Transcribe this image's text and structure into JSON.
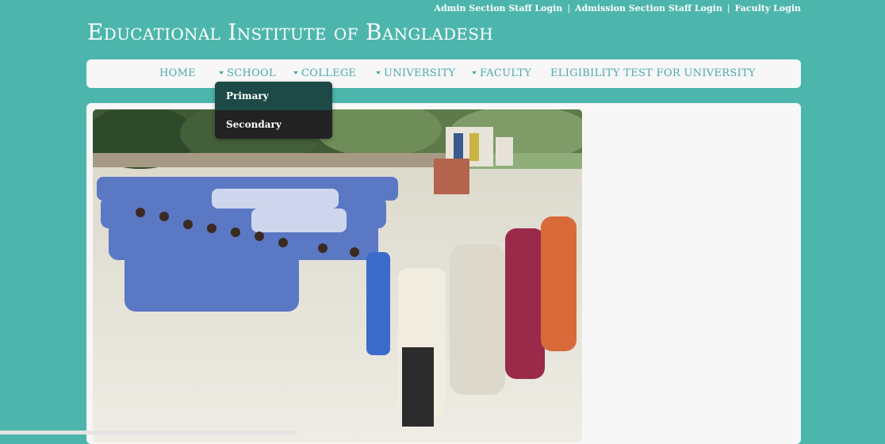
{
  "header": {
    "title": "Educational Institute of Bangladesh",
    "top_links": [
      "Admin Section Staff Login",
      "Admission Section Staff Login",
      "Faculty Login"
    ],
    "separator": "|"
  },
  "nav": {
    "items": [
      {
        "label": "HOME",
        "has_dropdown": false
      },
      {
        "label": "SCHOOL",
        "has_dropdown": true
      },
      {
        "label": "COLLEGE",
        "has_dropdown": true
      },
      {
        "label": "UNIVERSITY",
        "has_dropdown": true
      },
      {
        "label": "FACULTY",
        "has_dropdown": true
      },
      {
        "label": "ELIGIBILITY TEST FOR UNIVERSITY",
        "has_dropdown": false
      }
    ],
    "school_dropdown": [
      "Primary",
      "Secondary"
    ],
    "active_dropdown_item": "Primary"
  },
  "colors": {
    "background": "#4db6ac",
    "nav_text": "#4aa8ad",
    "dropdown_bg": "#222222",
    "dropdown_active": "#1d4a46"
  },
  "main": {
    "image": "school-assembly-photo"
  }
}
